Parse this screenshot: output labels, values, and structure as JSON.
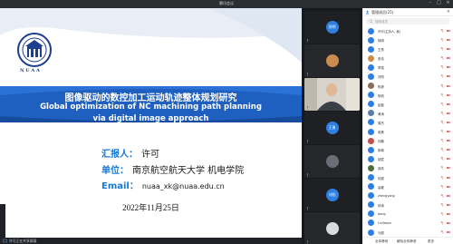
{
  "window": {
    "title": "腾讯会议",
    "controls": [
      "minimize",
      "maximize",
      "close"
    ]
  },
  "slide": {
    "logo_text": "N U A A",
    "title_cn": "图像驱动的数控加工运动轨迹整体规划研究",
    "title_en_line1": "Global optimization of NC machining path planning",
    "title_en_line2": "via digital image approach",
    "reporter_label": "汇报人：",
    "reporter_value": "许可",
    "unit_label": "单位：",
    "unit_value": "南京航空航天大学 机电学院",
    "email_label": "Email：",
    "email_value": "nuaa_xk@nuaa.edu.cn",
    "date": "2022年11月25日"
  },
  "status": {
    "share_text": "许可正在共享屏幕"
  },
  "video_tiles": [
    {
      "kind": "avatar",
      "avatar_text": "徐明",
      "color": "#1e2023",
      "avatar_color": "#2f7fe0"
    },
    {
      "kind": "photo",
      "color": "#25272b",
      "photo_color": "#c98b4e"
    },
    {
      "kind": "camera",
      "color": "#d8d4cc"
    },
    {
      "kind": "avatar",
      "avatar_text": "王勇",
      "color": "#1e2023",
      "avatar_color": "#2f7fe0"
    },
    {
      "kind": "photo",
      "color": "#25272b",
      "photo_color": "#6a6f76"
    },
    {
      "kind": "avatar",
      "avatar_text": "刘阳",
      "color": "#1e2023",
      "avatar_color": "#2f7fe0"
    },
    {
      "kind": "photo",
      "color": "#25272b",
      "photo_color": "#d9dadc"
    }
  ],
  "panel": {
    "title": "管理成员(25)",
    "search_placeholder": "搜索成员",
    "footer_buttons": [
      "全体静音",
      "解除全体静音",
      "更多"
    ],
    "participants": [
      {
        "name": "许可(主持人, 我)",
        "avatar_color": "#2f7fe0"
      },
      {
        "name": "徐明",
        "avatar_color": "#2f7fe0"
      },
      {
        "name": "王勇",
        "avatar_color": "#2f7fe0"
      },
      {
        "name": "张伟",
        "avatar_color": "#c98b4e"
      },
      {
        "name": "李强",
        "avatar_color": "#2f7fe0"
      },
      {
        "name": "刘阳",
        "avatar_color": "#2f7fe0"
      },
      {
        "name": "陈静",
        "avatar_color": "#8a6e5a"
      },
      {
        "name": "杨帆",
        "avatar_color": "#2f7fe0"
      },
      {
        "name": "赵磊",
        "avatar_color": "#2f7fe0"
      },
      {
        "name": "黄涛",
        "avatar_color": "#5b7ea8"
      },
      {
        "name": "周杰",
        "avatar_color": "#2f7fe0"
      },
      {
        "name": "吴昊",
        "avatar_color": "#2f7fe0"
      },
      {
        "name": "孙鹏",
        "avatar_color": "#c0504d"
      },
      {
        "name": "朱琳",
        "avatar_color": "#2f7fe0"
      },
      {
        "name": "胡斌",
        "avatar_color": "#2f7fe0"
      },
      {
        "name": "郭亮",
        "avatar_color": "#4e6e3a"
      },
      {
        "name": "何超",
        "avatar_color": "#2f7fe0"
      },
      {
        "name": "高峰",
        "avatar_color": "#2f7fe0"
      },
      {
        "name": "zhengyang",
        "avatar_color": "#2f7fe0"
      },
      {
        "name": "林涛",
        "avatar_color": "#2f7fe0"
      },
      {
        "name": "dong",
        "avatar_color": "#2f7fe0"
      },
      {
        "name": "LiuYaqun",
        "avatar_color": "#2f7fe0"
      },
      {
        "name": "马超",
        "avatar_color": "#2f7fe0"
      }
    ]
  }
}
